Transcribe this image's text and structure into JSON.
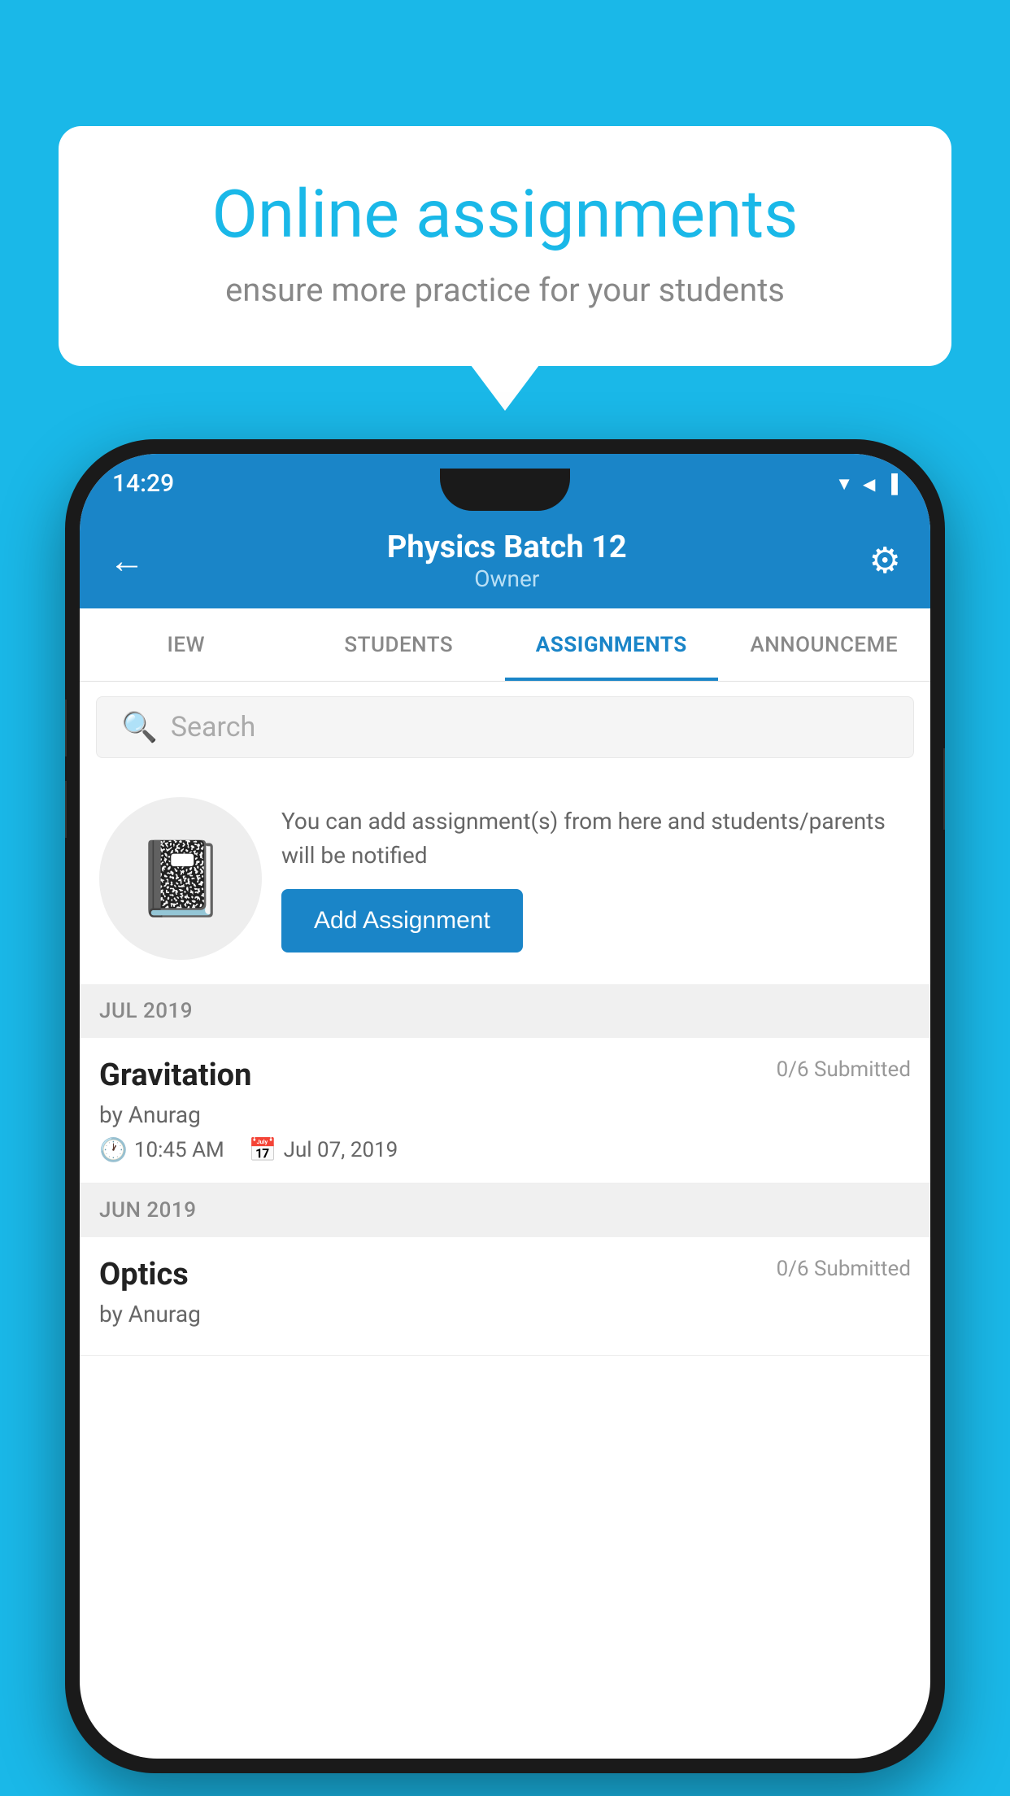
{
  "background_color": "#1ab8e8",
  "speech_bubble": {
    "title": "Online assignments",
    "subtitle": "ensure more practice for your students"
  },
  "phone": {
    "status_bar": {
      "time": "14:29"
    },
    "header": {
      "title": "Physics Batch 12",
      "subtitle": "Owner",
      "back_label": "←",
      "gear_label": "⚙"
    },
    "tabs": [
      {
        "label": "IEW",
        "active": false
      },
      {
        "label": "STUDENTS",
        "active": false
      },
      {
        "label": "ASSIGNMENTS",
        "active": true
      },
      {
        "label": "ANNOUNCEME",
        "active": false
      }
    ],
    "search": {
      "placeholder": "Search"
    },
    "promo": {
      "text": "You can add assignment(s) from here and students/parents will be notified",
      "button_label": "Add Assignment"
    },
    "sections": [
      {
        "month": "JUL 2019",
        "assignments": [
          {
            "name": "Gravitation",
            "submitted": "0/6 Submitted",
            "author": "by Anurag",
            "time": "10:45 AM",
            "date": "Jul 07, 2019"
          }
        ]
      },
      {
        "month": "JUN 2019",
        "assignments": [
          {
            "name": "Optics",
            "submitted": "0/6 Submitted",
            "author": "by Anurag",
            "time": "",
            "date": ""
          }
        ]
      }
    ]
  }
}
